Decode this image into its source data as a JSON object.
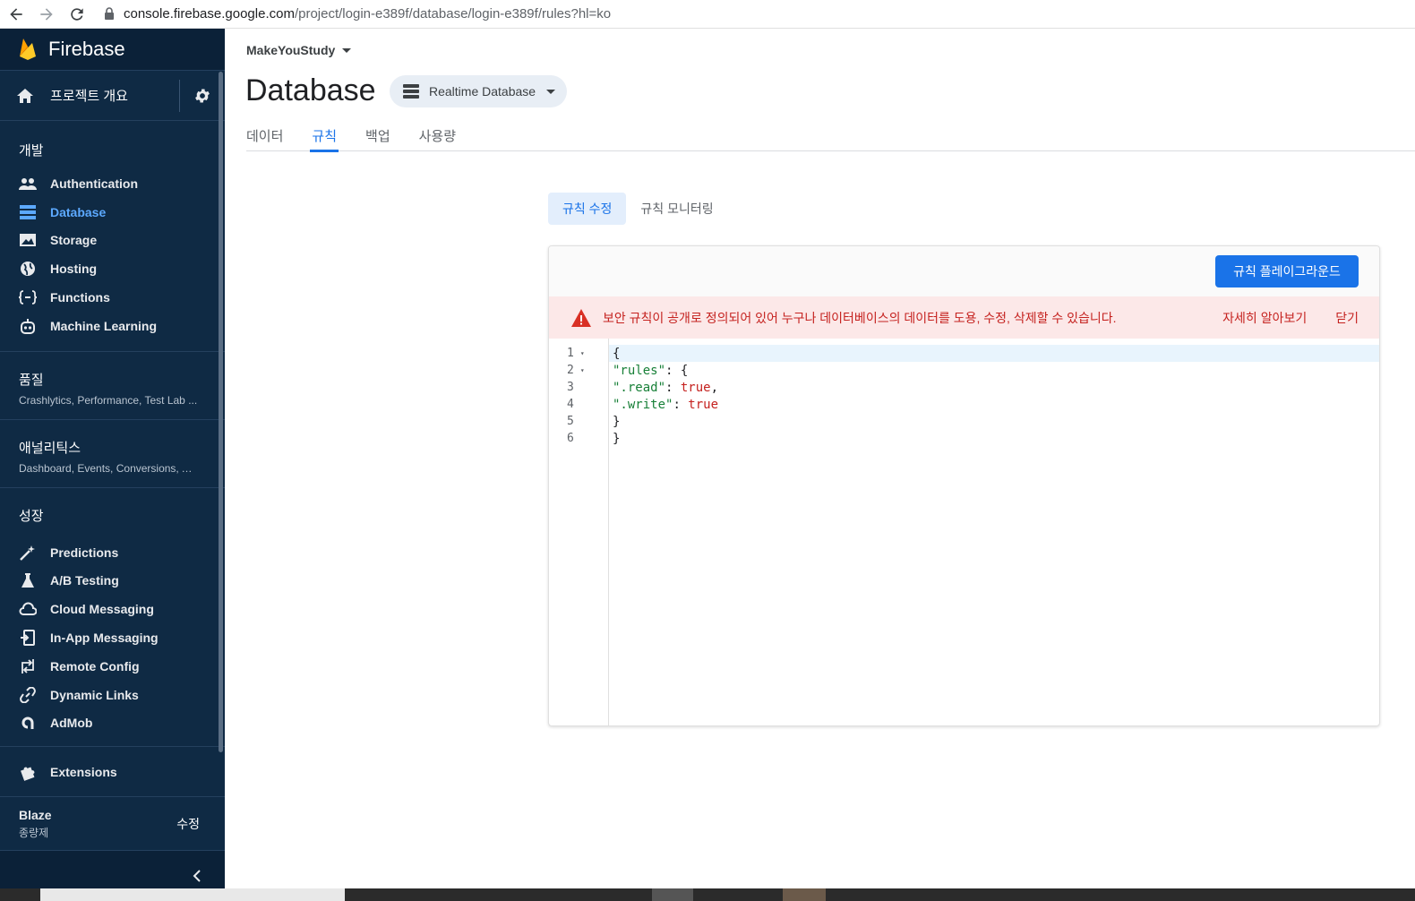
{
  "browser": {
    "url_host": "console.firebase.google.com",
    "url_path": "/project/login-e389f/database/login-e389f/rules?hl=ko"
  },
  "sidebar": {
    "brand": "Firebase",
    "project_overview": "프로젝트 개요",
    "develop_title": "개발",
    "develop_items": [
      {
        "label": "Authentication",
        "icon": "people-icon"
      },
      {
        "label": "Database",
        "icon": "database-icon"
      },
      {
        "label": "Storage",
        "icon": "image-icon"
      },
      {
        "label": "Hosting",
        "icon": "globe-icon"
      },
      {
        "label": "Functions",
        "icon": "functions-icon"
      },
      {
        "label": "Machine Learning",
        "icon": "robot-icon"
      }
    ],
    "quality": {
      "title": "품질",
      "subtitle": "Crashlytics, Performance, Test Lab ..."
    },
    "analytics": {
      "title": "애널리틱스",
      "subtitle": "Dashboard, Events, Conversions, Au..."
    },
    "grow_title": "성장",
    "grow_items": [
      {
        "label": "Predictions",
        "icon": "wand-icon"
      },
      {
        "label": "A/B Testing",
        "icon": "flask-icon"
      },
      {
        "label": "Cloud Messaging",
        "icon": "cloud-icon"
      },
      {
        "label": "In-App Messaging",
        "icon": "in-app-icon"
      },
      {
        "label": "Remote Config",
        "icon": "remote-config-icon"
      },
      {
        "label": "Dynamic Links",
        "icon": "link-icon"
      },
      {
        "label": "AdMob",
        "icon": "admob-icon"
      }
    ],
    "extensions": "Extensions",
    "plan": {
      "name": "Blaze",
      "type": "종량제",
      "edit": "수정"
    }
  },
  "header": {
    "project_name": "MakeYouStudy",
    "title": "Database",
    "db_selector": "Realtime Database"
  },
  "tabs": [
    "데이터",
    "규칙",
    "백업",
    "사용량"
  ],
  "active_tab": "규칙",
  "subtabs": [
    "규칙 수정",
    "규칙 모니터링"
  ],
  "card": {
    "playground_button": "규칙 플레이그라운드",
    "warning_text": "보안 규칙이 공개로 정의되어 있어 누구나 데이터베이스의 데이터를 도용, 수정, 삭제할 수 있습니다.",
    "warning_more": "자세히 알아보기",
    "warning_close": "닫기"
  },
  "editor": {
    "line_numbers": [
      "1",
      "2",
      "3",
      "4",
      "5",
      "6"
    ],
    "lines": [
      {
        "indent": "",
        "parts": [
          {
            "t": "{",
            "c": "plain"
          }
        ]
      },
      {
        "indent": "  ",
        "parts": [
          {
            "t": "\"rules\"",
            "c": "key"
          },
          {
            "t": ": {",
            "c": "plain"
          }
        ]
      },
      {
        "indent": "    ",
        "parts": [
          {
            "t": "\".read\"",
            "c": "key"
          },
          {
            "t": ": ",
            "c": "plain"
          },
          {
            "t": "true",
            "c": "bool"
          },
          {
            "t": ",",
            "c": "plain"
          }
        ]
      },
      {
        "indent": "    ",
        "parts": [
          {
            "t": "\".write\"",
            "c": "key"
          },
          {
            "t": ": ",
            "c": "plain"
          },
          {
            "t": "true",
            "c": "bool"
          }
        ]
      },
      {
        "indent": "  ",
        "parts": [
          {
            "t": "}",
            "c": "plain"
          }
        ]
      },
      {
        "indent": "",
        "parts": [
          {
            "t": "}",
            "c": "plain"
          }
        ]
      }
    ]
  },
  "colors": {
    "sidebar_bg": "#0f2a44",
    "accent": "#1a73e8",
    "warning": "#c5221f",
    "active_nav": "#5ca9ff"
  }
}
